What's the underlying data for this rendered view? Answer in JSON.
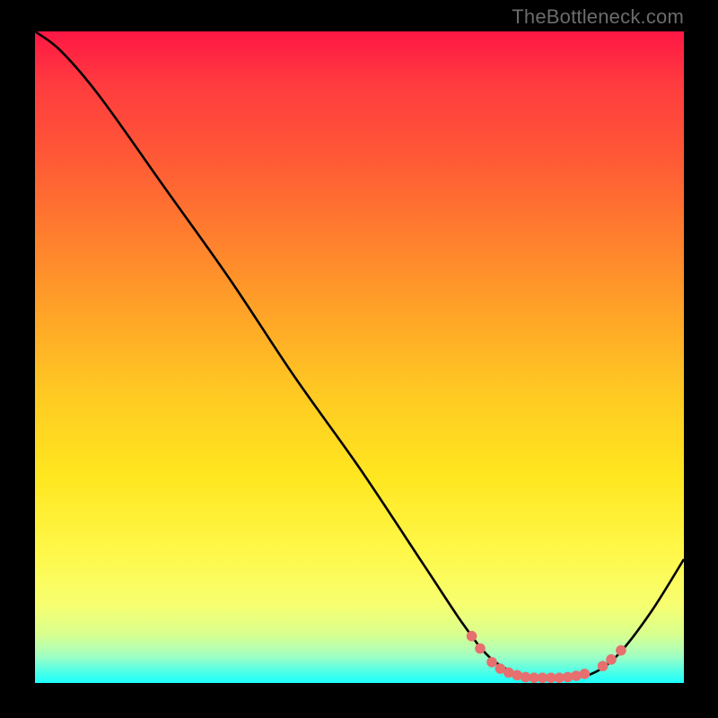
{
  "watermark": "TheBottleneck.com",
  "chart_data": {
    "type": "line",
    "title": "",
    "xlabel": "",
    "ylabel": "",
    "xlim": [
      0,
      100
    ],
    "ylim": [
      0,
      100
    ],
    "curve": {
      "name": "bottleneck-curve",
      "color": "#000000",
      "points": [
        {
          "x": 0,
          "y": 100
        },
        {
          "x": 4,
          "y": 97
        },
        {
          "x": 10,
          "y": 90
        },
        {
          "x": 20,
          "y": 76
        },
        {
          "x": 30,
          "y": 62
        },
        {
          "x": 40,
          "y": 47
        },
        {
          "x": 50,
          "y": 33
        },
        {
          "x": 60,
          "y": 18
        },
        {
          "x": 66,
          "y": 9
        },
        {
          "x": 70,
          "y": 4
        },
        {
          "x": 74,
          "y": 1.5
        },
        {
          "x": 78,
          "y": 0.8
        },
        {
          "x": 82,
          "y": 0.8
        },
        {
          "x": 86,
          "y": 1.5
        },
        {
          "x": 90,
          "y": 4.5
        },
        {
          "x": 95,
          "y": 11
        },
        {
          "x": 100,
          "y": 19
        }
      ]
    },
    "markers": {
      "name": "highlight-dots",
      "color": "#e76f6f",
      "points": [
        {
          "x": 67.3,
          "y": 7.2
        },
        {
          "x": 68.6,
          "y": 5.3
        },
        {
          "x": 70.4,
          "y": 3.2
        },
        {
          "x": 71.7,
          "y": 2.2
        },
        {
          "x": 73.0,
          "y": 1.6
        },
        {
          "x": 74.3,
          "y": 1.2
        },
        {
          "x": 75.6,
          "y": 0.9
        },
        {
          "x": 76.9,
          "y": 0.8
        },
        {
          "x": 78.2,
          "y": 0.8
        },
        {
          "x": 79.5,
          "y": 0.8
        },
        {
          "x": 80.8,
          "y": 0.8
        },
        {
          "x": 82.1,
          "y": 0.9
        },
        {
          "x": 83.4,
          "y": 1.1
        },
        {
          "x": 84.7,
          "y": 1.4
        },
        {
          "x": 87.5,
          "y": 2.6
        },
        {
          "x": 88.8,
          "y": 3.6
        },
        {
          "x": 90.3,
          "y": 5.0
        }
      ]
    }
  }
}
